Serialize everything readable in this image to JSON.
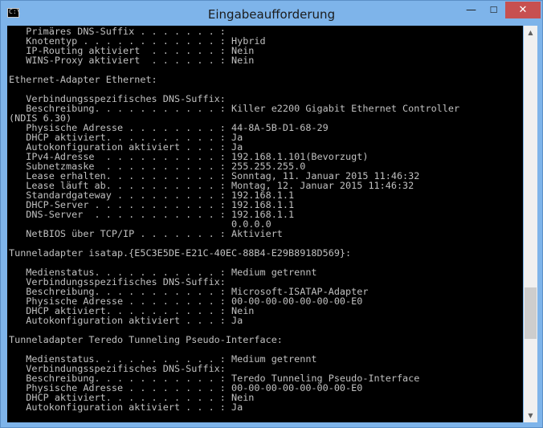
{
  "window": {
    "title": "Eingabeaufforderung",
    "icon": "cmd-icon",
    "icon_glyph": "C:\\",
    "minimize_glyph": "—",
    "maximize_glyph": "☐",
    "close_glyph": "✕"
  },
  "scrollbar": {
    "up_glyph": "▲",
    "down_glyph": "▼",
    "position_fraction": 0.78
  },
  "console": {
    "text": "   Primäres DNS-Suffix . . . . . . . : \n   Knotentyp . . . . . . . . . . . . : Hybrid\n   IP-Routing aktiviert  . . . . . . : Nein\n   WINS-Proxy aktiviert  . . . . . . : Nein\n\nEthernet-Adapter Ethernet:\n\n   Verbindungsspezifisches DNS-Suffix: \n   Beschreibung. . . . . . . . . . . : Killer e2200 Gigabit Ethernet Controller\n(NDIS 6.30)\n   Physische Adresse . . . . . . . . : 44-8A-5B-D1-68-29\n   DHCP aktiviert. . . . . . . . . . : Ja\n   Autokonfiguration aktiviert . . . : Ja\n   IPv4-Adresse  . . . . . . . . . . : 192.168.1.101(Bevorzugt)\n   Subnetzmaske  . . . . . . . . . . : 255.255.255.0\n   Lease erhalten. . . . . . . . . . : Sonntag, 11. Januar 2015 11:46:32\n   Lease läuft ab. . . . . . . . . . : Montag, 12. Januar 2015 11:46:32\n   Standardgateway . . . . . . . . . : 192.168.1.1\n   DHCP-Server . . . . . . . . . . . : 192.168.1.1\n   DNS-Server  . . . . . . . . . . . : 192.168.1.1\n                                       0.0.0.0\n   NetBIOS über TCP/IP . . . . . . . : Aktiviert\n\nTunneladapter isatap.{E5C3E5DE-E21C-40EC-88B4-E29B8918D569}:\n\n   Medienstatus. . . . . . . . . . . : Medium getrennt\n   Verbindungsspezifisches DNS-Suffix: \n   Beschreibung. . . . . . . . . . . : Microsoft-ISATAP-Adapter\n   Physische Adresse . . . . . . . . : 00-00-00-00-00-00-00-E0\n   DHCP aktiviert. . . . . . . . . . : Nein\n   Autokonfiguration aktiviert . . . : Ja\n\nTunneladapter Teredo Tunneling Pseudo-Interface:\n\n   Medienstatus. . . . . . . . . . . : Medium getrennt\n   Verbindungsspezifisches DNS-Suffix: \n   Beschreibung. . . . . . . . . . . : Teredo Tunneling Pseudo-Interface\n   Physische Adresse . . . . . . . . : 00-00-00-00-00-00-00-E0\n   DHCP aktiviert. . . . . . . . . . : Nein\n   Autokonfiguration aktiviert . . . : Ja"
  },
  "colors": {
    "frame": "#7eb4ea",
    "console_bg": "#000000",
    "console_fg": "#c0c0c0",
    "close_button": "#c75050"
  }
}
